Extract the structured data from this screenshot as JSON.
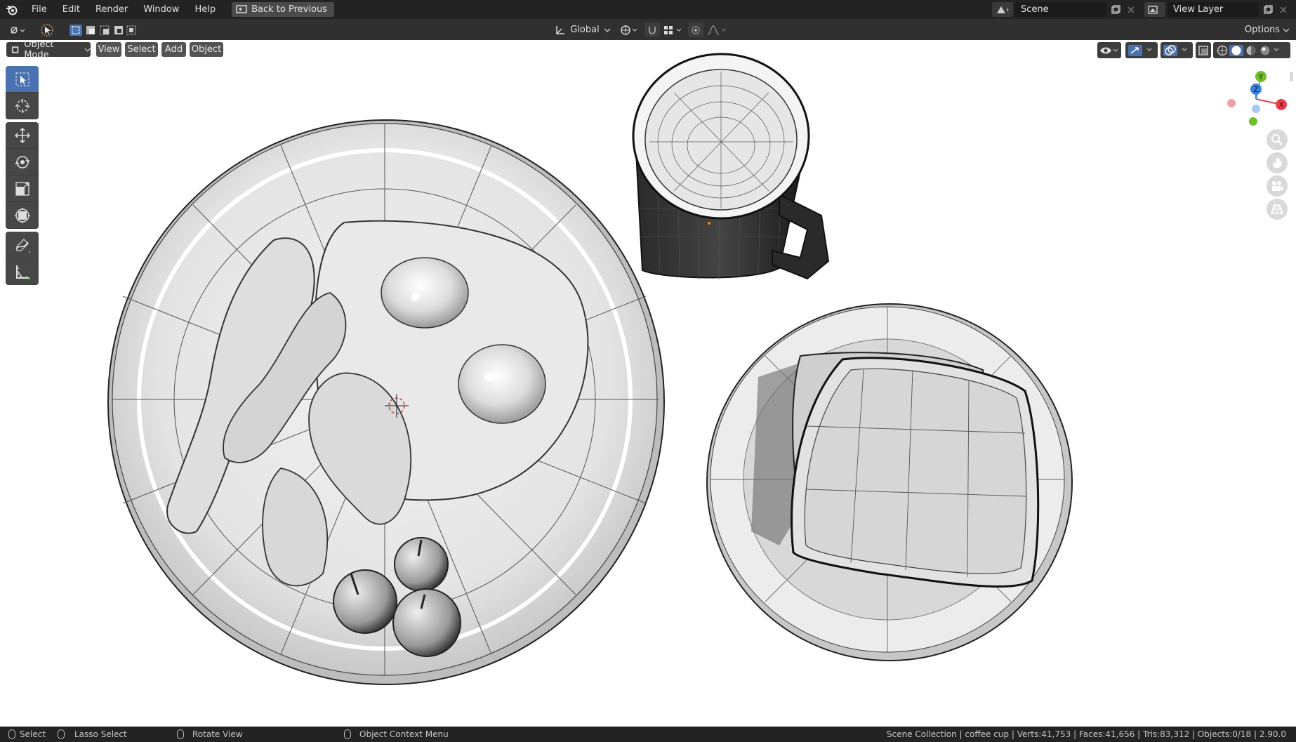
{
  "menubar": {
    "items": [
      "File",
      "Edit",
      "Render",
      "Window",
      "Help"
    ],
    "back_button": "Back to Previous",
    "scene_label": "Scene",
    "view_layer_label": "View Layer"
  },
  "toolbar": {
    "transform_orientation": "Global",
    "options_label": "Options"
  },
  "viewport_header": {
    "mode": "Object Mode",
    "menus": [
      "View",
      "Select",
      "Add",
      "Object"
    ]
  },
  "gizmo": {
    "axis_y": "Y",
    "axis_z": "Z",
    "axis_x": "X",
    "color_x": "#e8404e",
    "color_y": "#6fbf28",
    "color_z": "#3a82e0"
  },
  "tools": [
    "select-box-tool",
    "cursor-tool",
    "move-tool",
    "rotate-tool",
    "scale-tool",
    "transform-tool",
    "annotate-tool",
    "measure-tool"
  ],
  "statusbar": {
    "select": "Select",
    "lasso": "Lasso Select",
    "rotate": "Rotate View",
    "context": "Object Context Menu",
    "stats": "Scene Collection | coffee cup | Verts:41,753 | Faces:41,656 | Tris:83,312 | Objects:0/18 | 2.90.0"
  },
  "colors": {
    "accent": "#4a72b0",
    "menubar_bg": "#232323",
    "toolbar_bg": "#303030"
  }
}
